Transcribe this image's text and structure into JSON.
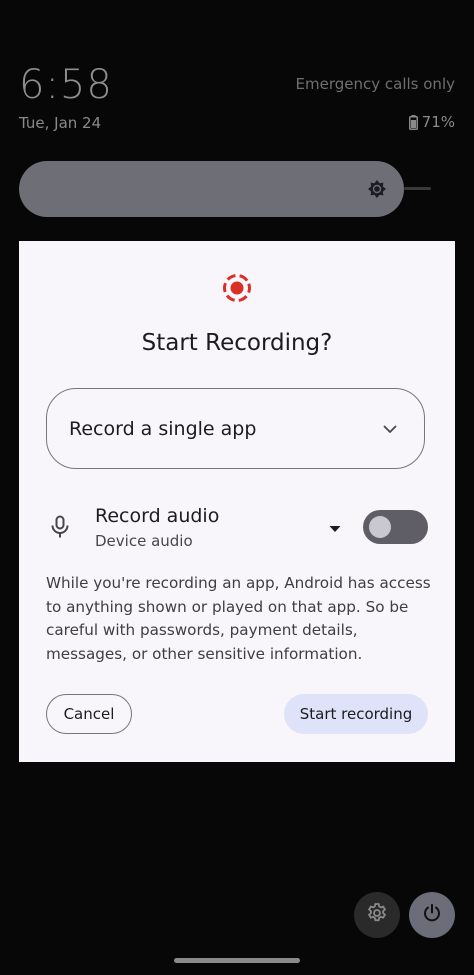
{
  "status": {
    "time": "6:58",
    "date": "Tue, Jan 24",
    "network": "Emergency calls only",
    "battery": "71%",
    "battery_icon": "battery-icon"
  },
  "quick_settings": {
    "brightness_icon": "brightness-icon"
  },
  "dialog": {
    "icon": "screen-record-icon",
    "title": "Start Recording?",
    "mode_select": {
      "value": "Record a single app",
      "icon": "chevron-down-icon"
    },
    "audio": {
      "title": "Record audio",
      "source": "Device audio",
      "enabled": false,
      "icon": "mic-icon"
    },
    "message": "While you're recording an app, Android has access to anything shown or played on that app. So be careful with passwords, payment details, messages, or other sensitive information.",
    "cancel_label": "Cancel",
    "start_label": "Start recording"
  },
  "bottom": {
    "settings_icon": "gear-icon",
    "power_icon": "power-icon"
  },
  "colors": {
    "accent_red": "#d93025",
    "dialog_bg": "#f8f6fb",
    "primary_button_bg": "#dfe3f9"
  }
}
